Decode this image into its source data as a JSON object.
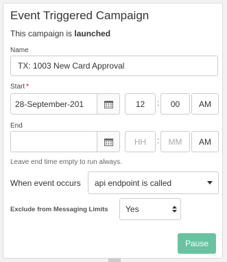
{
  "title": "Event Triggered Campaign",
  "status_prefix": "This campaign is ",
  "status_value": "launched",
  "name": {
    "label": "Name",
    "value": "TX: 1003 New Card Approval"
  },
  "start": {
    "label": "Start",
    "required_mark": "*",
    "date_value": "28-September-201",
    "hour": "12",
    "minute": "00",
    "ampm": "AM",
    "calendar_icon": "calendar-icon"
  },
  "end": {
    "label": "End",
    "date_value": "",
    "hour_placeholder": "HH",
    "minute_placeholder": "MM",
    "ampm": "AM",
    "calendar_icon": "calendar-icon"
  },
  "time_separator": ":",
  "hint": "Leave end time empty to run always.",
  "event": {
    "label": "When event occurs",
    "selected": "api endpoint is called"
  },
  "exclude": {
    "label": "Exclude from Messaging Limits",
    "selected": "Yes"
  },
  "pause_label": "Pause"
}
